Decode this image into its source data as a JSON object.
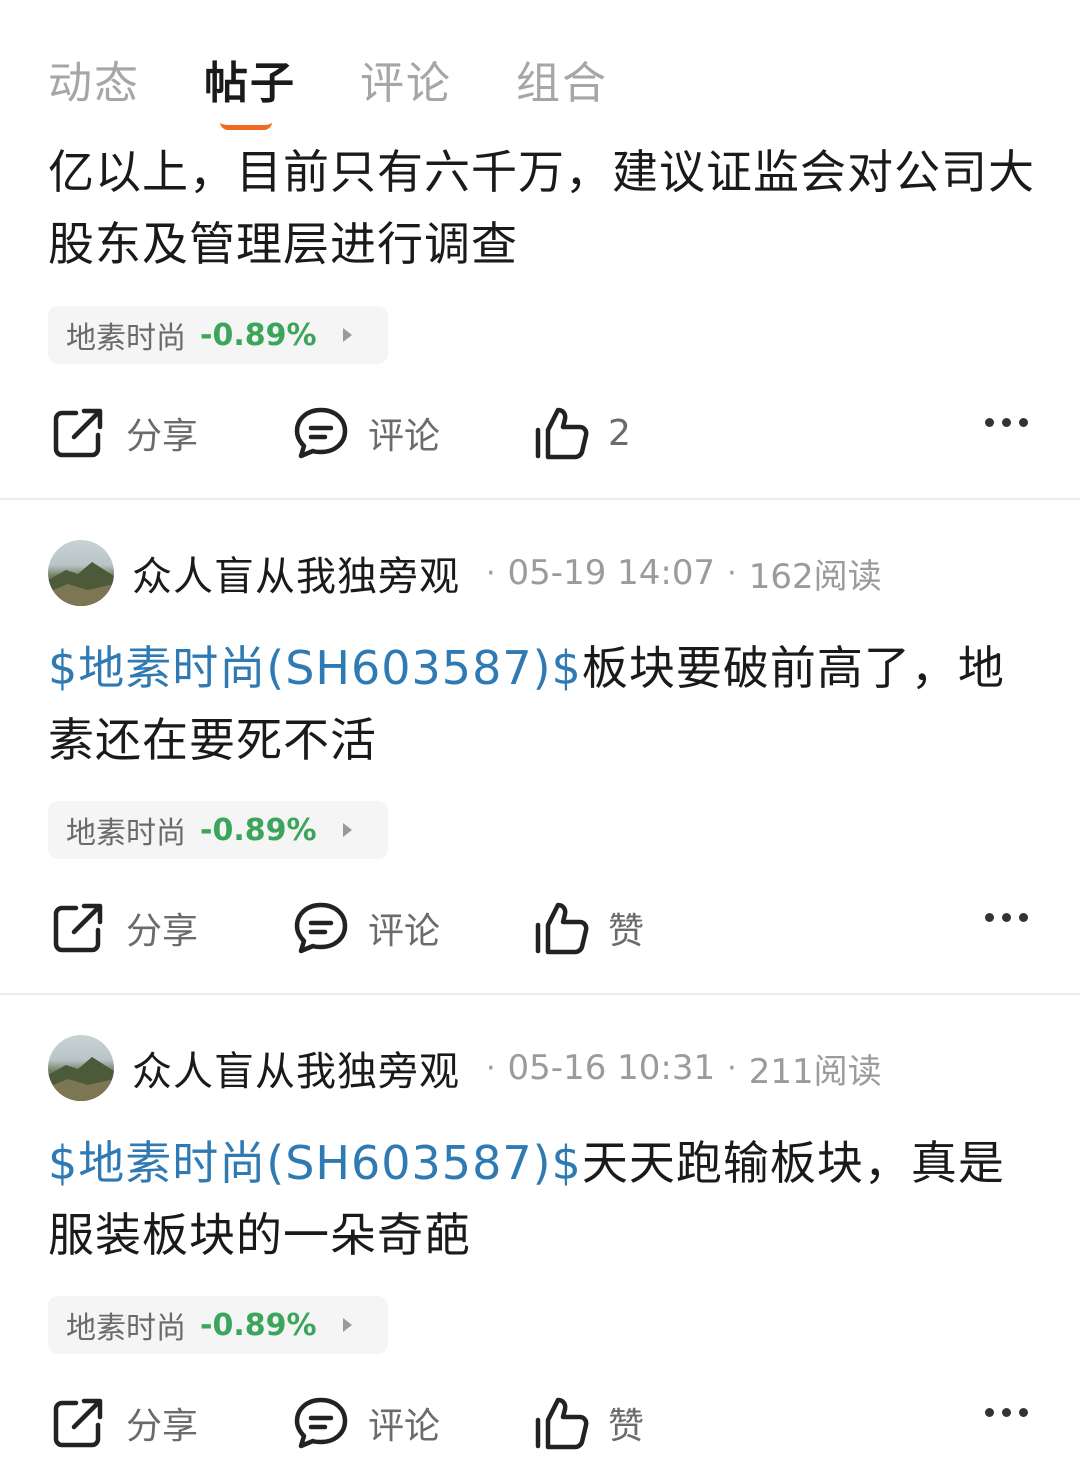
{
  "tabs": [
    {
      "label": "动态"
    },
    {
      "label": "帖子"
    },
    {
      "label": "评论"
    },
    {
      "label": "组合"
    }
  ],
  "active_tab": "帖子",
  "colors": {
    "accent": "#f06a23",
    "link": "#2f7ab2",
    "down_green": "#3ca55c"
  },
  "posts": [
    {
      "text": "亿以上，目前只有六千万，建议证监会对公司大股东及管理层进行调查",
      "stock_chip": {
        "name": "地素时尚",
        "change": "-0.89%"
      },
      "actions": {
        "share": "分享",
        "comment": "评论",
        "like": "2"
      }
    },
    {
      "author": "众人盲从我独旁观",
      "time": "05-19 14:07",
      "reads": "162阅读",
      "stock_link": "$地素时尚(SH603587)$",
      "text": "板块要破前高了，地素还在要死不活",
      "stock_chip": {
        "name": "地素时尚",
        "change": "-0.89%"
      },
      "actions": {
        "share": "分享",
        "comment": "评论",
        "like": "赞"
      }
    },
    {
      "author": "众人盲从我独旁观",
      "time": "05-16 10:31",
      "reads": "211阅读",
      "stock_link": "$地素时尚(SH603587)$",
      "text": "天天跑输板块，真是服装板块的一朵奇葩",
      "stock_chip": {
        "name": "地素时尚",
        "change": "-0.89%"
      },
      "actions": {
        "share": "分享",
        "comment": "评论",
        "like": "赞"
      }
    }
  ],
  "icons": {
    "share": "share-icon",
    "comment": "comment-icon",
    "like": "thumbs-up-icon",
    "more": "more-icon",
    "chip_arrow": "play-arrow-icon"
  }
}
